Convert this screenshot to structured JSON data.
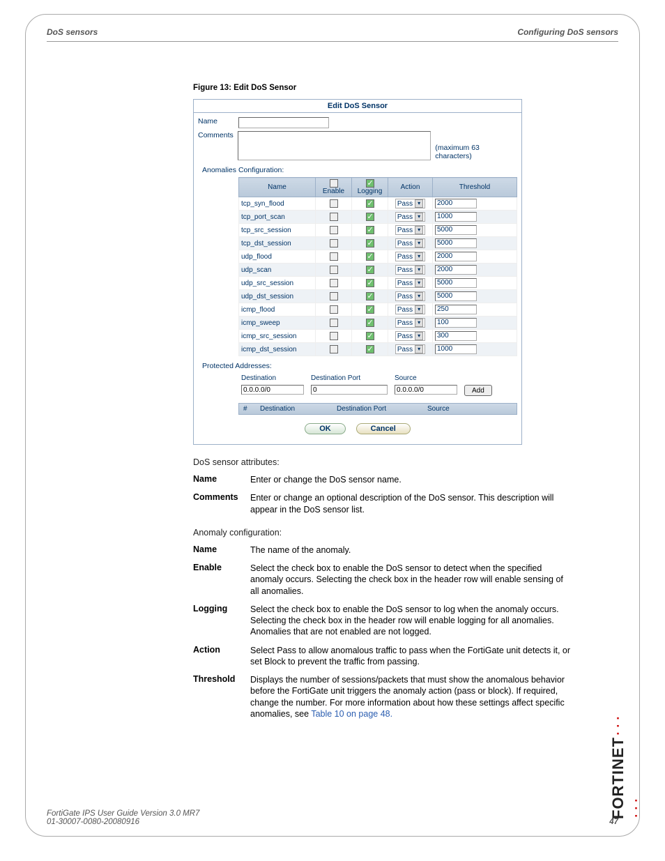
{
  "header": {
    "left": "DoS sensors",
    "right": "Configuring DoS sensors"
  },
  "figure_caption": "Figure 13: Edit DoS Sensor",
  "screenshot": {
    "title": "Edit DoS Sensor",
    "name_label": "Name",
    "comments_label": "Comments",
    "maxchars": "(maximum 63 characters)",
    "anom_section": "Anomalies Configuration:",
    "cols": {
      "name": "Name",
      "enable": "Enable",
      "logging": "Logging",
      "action": "Action",
      "threshold": "Threshold"
    },
    "action_value": "Pass",
    "rows": [
      {
        "name": "tcp_syn_flood",
        "threshold": "2000"
      },
      {
        "name": "tcp_port_scan",
        "threshold": "1000"
      },
      {
        "name": "tcp_src_session",
        "threshold": "5000"
      },
      {
        "name": "tcp_dst_session",
        "threshold": "5000"
      },
      {
        "name": "udp_flood",
        "threshold": "2000"
      },
      {
        "name": "udp_scan",
        "threshold": "2000"
      },
      {
        "name": "udp_src_session",
        "threshold": "5000"
      },
      {
        "name": "udp_dst_session",
        "threshold": "5000"
      },
      {
        "name": "icmp_flood",
        "threshold": "250"
      },
      {
        "name": "icmp_sweep",
        "threshold": "100"
      },
      {
        "name": "icmp_src_session",
        "threshold": "300"
      },
      {
        "name": "icmp_dst_session",
        "threshold": "1000"
      }
    ],
    "protected_section": "Protected Addresses:",
    "prot_head": {
      "dest": "Destination",
      "destport": "Destination Port",
      "source": "Source"
    },
    "prot_row": {
      "dest": "0.0.0.0/0",
      "destport": "0",
      "source": "0.0.0.0/0"
    },
    "add": "Add",
    "list_head": {
      "num": "#",
      "dest": "Destination",
      "destport": "Destination Port",
      "source": "Source"
    },
    "ok": "OK",
    "cancel": "Cancel"
  },
  "attr_intro": "DoS sensor attributes:",
  "attrs1": [
    {
      "label": "Name",
      "desc": "Enter or change the DoS sensor name."
    },
    {
      "label": "Comments",
      "desc": "Enter or change an optional description of the DoS sensor. This description will appear in the DoS sensor list."
    }
  ],
  "anom_intro": "Anomaly configuration:",
  "attrs2": [
    {
      "label": "Name",
      "desc": "The name of the anomaly."
    },
    {
      "label": "Enable",
      "desc": "Select the check box to enable the DoS sensor to detect when the specified anomaly occurs. Selecting the check box in the header row will enable sensing of all anomalies."
    },
    {
      "label": "Logging",
      "desc": "Select the check box to enable the DoS sensor to log when the anomaly occurs. Selecting the check box in the header row will enable logging for all anomalies. Anomalies that are not enabled are not logged."
    },
    {
      "label": "Action",
      "desc": "Select Pass to allow anomalous traffic to pass when the FortiGate unit detects it, or set Block to prevent the traffic from passing."
    },
    {
      "label": "Threshold",
      "desc": "Displays the number of sessions/packets that must show the anomalous behavior before the FortiGate unit triggers the anomaly action (pass or block). If required, change the number. For more information about how these settings affect specific anomalies, see ",
      "link": "Table 10 on page 48."
    }
  ],
  "footer": {
    "line1": "FortiGate IPS User Guide Version 3.0 MR7",
    "line2": "01-30007-0080-20080916",
    "page": "47"
  },
  "brand": "FORTINET"
}
